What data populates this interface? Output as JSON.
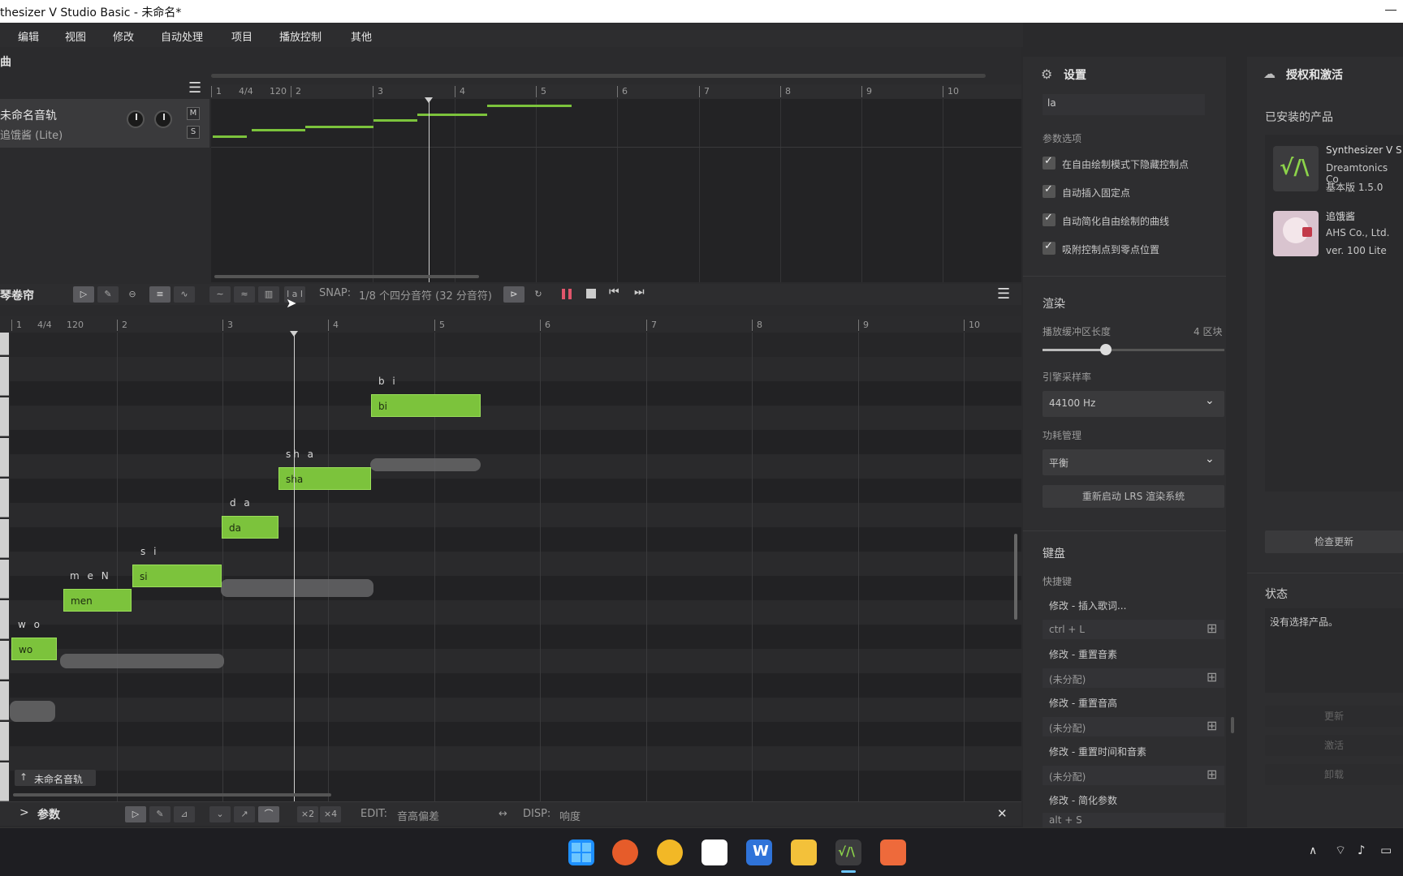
{
  "window": {
    "title": "thesizer V Studio Basic - 未命名*"
  },
  "menu": [
    "编辑",
    "视图",
    "修改",
    "自动处理",
    "项目",
    "播放控制",
    "其他"
  ],
  "arrangement": {
    "section_label": "曲",
    "ruler": [
      "1",
      "4/4",
      "120",
      "2",
      "3",
      "4",
      "5",
      "6",
      "7",
      "8",
      "9",
      "10"
    ],
    "track": {
      "name": "未命名音轨",
      "voice": "追饿酱 (Lite)",
      "mute_label": "M",
      "solo_label": "S"
    }
  },
  "piano_roll": {
    "section_label": "琴卷帘",
    "snap_label": "SNAP:",
    "snap_value": "1/8 个四分音符 (32 分音符)",
    "ruler": [
      "1",
      "4/4",
      "120",
      "2",
      "3",
      "4",
      "5",
      "6",
      "7",
      "8",
      "9",
      "10"
    ],
    "notes": [
      {
        "text": "wo",
        "lyric": "w o"
      },
      {
        "text": "men",
        "lyric": "m e N"
      },
      {
        "text": "si",
        "lyric": "s i"
      },
      {
        "text": "da",
        "lyric": "d a"
      },
      {
        "text": "sha",
        "lyric": "sh a"
      },
      {
        "text": "bi",
        "lyric": "b i"
      }
    ],
    "track_chip": "未命名音轨",
    "lyric_toggle": "l a l"
  },
  "param_bar": {
    "label": "参数",
    "x2": "×2",
    "x4": "×4",
    "edit_label": "EDIT:",
    "edit_value": "音高偏差",
    "disp_label": "DISP:",
    "disp_value": "响度",
    "close": "✕"
  },
  "settings": {
    "title": "设置",
    "top_input_value": "la",
    "param_options_heading": "参数选项",
    "checkboxes": [
      "在自由绘制模式下隐藏控制点",
      "自动插入固定点",
      "自动简化自由绘制的曲线",
      "吸附控制点到零点位置"
    ],
    "render_heading": "渲染",
    "buffer_label": "播放缓冲区长度",
    "buffer_value": "4 区块",
    "buffer_fraction": 0.35,
    "sample_rate_label": "引擎采样率",
    "sample_rate_value": "44100 Hz",
    "power_label": "功耗管理",
    "power_value": "平衡",
    "restart_button": "重新启动 LRS 渲染系统",
    "keyboard_heading": "键盘",
    "shortcut_heading": "快捷键",
    "shortcuts": [
      {
        "name": "修改 - 插入歌词...",
        "key": "ctrl + L"
      },
      {
        "name": "修改 - 重置音素",
        "key": "(未分配)"
      },
      {
        "name": "修改 - 重置音高",
        "key": "(未分配)"
      },
      {
        "name": "修改 - 重置时间和音素",
        "key": "(未分配)"
      },
      {
        "name": "修改 - 简化参数",
        "key": "alt + S"
      }
    ]
  },
  "auth": {
    "title": "授权和激活",
    "installed_heading": "已安装的产品",
    "products": [
      {
        "line1": "Synthesizer V S",
        "line2": "Dreamtonics Co",
        "line3": "基本版 1.5.0"
      },
      {
        "line1": "追饿酱",
        "line2": "AHS Co., Ltd.",
        "line3": "ver. 100 Lite"
      }
    ],
    "check_update": "检查更新",
    "status_heading": "状态",
    "status_text": "没有选择产品。",
    "buttons": [
      "更新",
      "激活",
      "卸载"
    ]
  }
}
